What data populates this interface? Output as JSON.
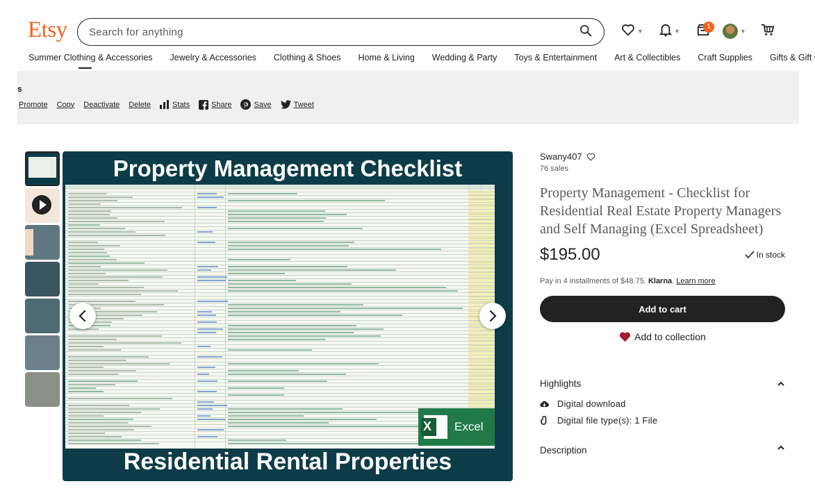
{
  "header": {
    "logo": "Etsy",
    "search_placeholder": "Search for anything",
    "cart_badge": "1"
  },
  "nav": {
    "items": [
      "Summer Clothing & Accessories",
      "Jewelry & Accessories",
      "Clothing & Shoes",
      "Home & Living",
      "Wedding & Party",
      "Toys & Entertainment",
      "Art & Collectibles",
      "Craft Supplies",
      "Gifts & Gift Cards"
    ]
  },
  "owner_bar": {
    "label": "s",
    "links": [
      "Promote",
      "Copy",
      "Deactivate",
      "Delete",
      "Stats",
      "Share",
      "Save",
      "Tweet"
    ]
  },
  "gallery": {
    "title_top": "Property Management Checklist",
    "title_bottom": "Residential Rental Properties",
    "excel_label": "Excel",
    "excel_letter": "X"
  },
  "listing": {
    "shop_name": "Swany407",
    "sales": "76 sales",
    "title": "Property Management - Checklist for Residential Real Estate Property Managers and Self Managing (Excel Spreadsheet)",
    "price": "$195.00",
    "stock": "In stock",
    "installments_prefix": "Pay in 4 installments of $48.75.",
    "installments_brand": "Klarna",
    "installments_link": "Learn more",
    "add_to_cart": "Add to cart",
    "add_to_collection": "Add to collection",
    "highlights_heading": "Highlights",
    "highlights": [
      "Digital download",
      "Digital file type(s): 1 File"
    ],
    "description_heading": "Description"
  },
  "colors": {
    "brand": "#f1641e",
    "image_bg": "#0d3c48",
    "excel_green": "#1f7a47",
    "heart": "#a61a2e"
  }
}
